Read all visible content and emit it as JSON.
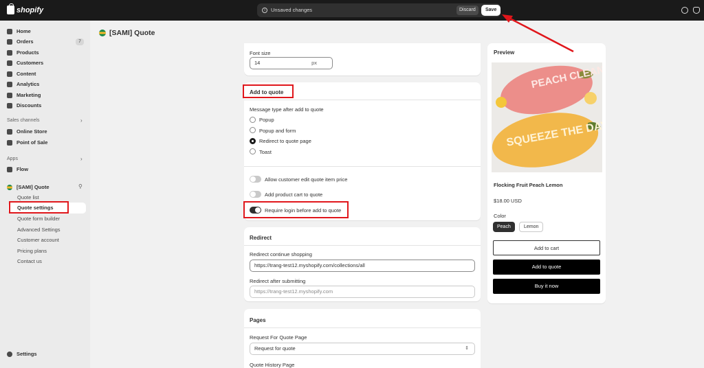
{
  "topbar": {
    "logo_text": "shopify",
    "unsaved_text": "Unsaved changes",
    "discard_label": "Discard",
    "save_label": "Save"
  },
  "sidebar": {
    "items": [
      {
        "label": "Home",
        "icon": "home-icon"
      },
      {
        "label": "Orders",
        "icon": "orders-icon",
        "badge": "7"
      },
      {
        "label": "Products",
        "icon": "tag-icon"
      },
      {
        "label": "Customers",
        "icon": "person-icon"
      },
      {
        "label": "Content",
        "icon": "content-icon"
      },
      {
        "label": "Analytics",
        "icon": "chart-icon"
      },
      {
        "label": "Marketing",
        "icon": "target-icon"
      },
      {
        "label": "Discounts",
        "icon": "discount-icon"
      }
    ],
    "sales_channels_title": "Sales channels",
    "sales_channels": [
      {
        "label": "Online Store",
        "icon": "store-icon"
      },
      {
        "label": "Point of Sale",
        "icon": "pos-icon"
      }
    ],
    "apps_title": "Apps",
    "apps": [
      {
        "label": "Flow",
        "icon": "flow-icon"
      }
    ],
    "app_name": "[SAMI] Quote",
    "app_subitems": [
      "Quote list",
      "Quote settings",
      "Quote form builder",
      "Advanced Settings",
      "Customer account",
      "Pricing plans",
      "Contact us"
    ],
    "settings_label": "Settings"
  },
  "page": {
    "title": "[SAMI] Quote"
  },
  "font_card": {
    "label": "Font size",
    "value": "14",
    "unit": "px"
  },
  "add_to_quote": {
    "title": "Add to quote",
    "message_type_label": "Message type after add to quote",
    "options": [
      "Popup",
      "Popup and form",
      "Redirect to quote page",
      "Toast"
    ],
    "selected": "Redirect to quote page",
    "toggles": [
      {
        "label": "Allow customer edit quote item price",
        "on": false
      },
      {
        "label": "Add product cart to quote",
        "on": false
      },
      {
        "label": "Require login before add to quote",
        "on": true
      }
    ]
  },
  "redirect": {
    "title": "Redirect",
    "continue_label": "Redirect continue shopping",
    "continue_value": "https://trang-test12.myshopify.com/collections/all",
    "after_label": "Redirect after submitting",
    "after_placeholder": "https://trang-test12.myshopify.com"
  },
  "pages": {
    "title": "Pages",
    "rfq_label": "Request For Quote Page",
    "rfq_value": "Request for quote",
    "history_label": "Quote History Page"
  },
  "preview": {
    "title": "Preview",
    "product_name": "Flocking Fruit Peach Lemon",
    "price": "$18.00 USD",
    "color_label": "Color",
    "colors": [
      "Peach",
      "Lemon"
    ],
    "selected_color": "Peach",
    "add_to_cart": "Add to cart",
    "add_to_quote": "Add to quote",
    "buy_now": "Buy it now",
    "image_text_top": "PEACH CLEAN",
    "image_text_bottom": "SQUEEZE THE DAY"
  },
  "colors": {
    "accent_red": "#e0161b",
    "dark": "#1a1a1a"
  }
}
